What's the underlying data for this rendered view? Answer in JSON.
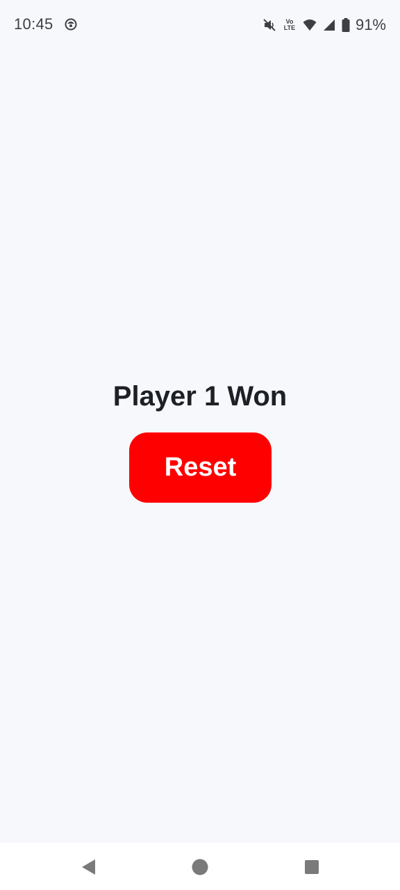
{
  "status_bar": {
    "time": "10:45",
    "app_icon": "app-notification-icon",
    "icons": [
      "mute-icon",
      "volte-icon",
      "wifi-icon",
      "signal-icon",
      "battery-icon"
    ],
    "volte_top": "Vo",
    "volte_bottom": "LTE",
    "battery_percent": "91%"
  },
  "main": {
    "result_text": "Player 1 Won",
    "reset_label": "Reset"
  },
  "colors": {
    "background": "#f6f8fc",
    "button": "#ff0000",
    "button_text": "#ffffff",
    "result_text": "#1d2026"
  },
  "nav_bar": {
    "buttons": [
      "back-icon",
      "home-icon",
      "recents-icon"
    ]
  }
}
